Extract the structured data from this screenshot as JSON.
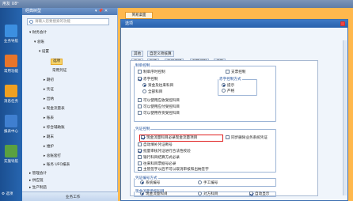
{
  "window": {
    "title": "用友 U8⁺"
  },
  "left_nav": [
    {
      "label": "业务导航",
      "color": "#3c8fe0"
    },
    {
      "label": "常用功能",
      "color": "#e8752a"
    },
    {
      "label": "消息任务",
      "color": "#f0a020"
    },
    {
      "label": "报表中心",
      "color": "#3f7fd0"
    },
    {
      "label": "实施导航",
      "color": "#5aa040"
    }
  ],
  "left_nav_bottom": "⚙ 选项",
  "sidebar": {
    "title": "经典树型",
    "controls": "▾ 📌 ✕",
    "search_placeholder": "请输入您要搜索的功能",
    "tree": [
      "▾ 财务会计",
      "▾ 总账",
      "▾ 设置",
      "选项",
      "常用凭证",
      "▸ 期初",
      "▸ 凭证",
      "▸ 出纳",
      "▸ 现金流量表",
      "▸ 账表",
      "▸ 综合辅助账",
      "▸ 期末",
      "▸ 维护",
      "▸ 总账套打",
      "▸ 账务 UFO报表",
      "▸ 管理会计",
      "▸ 供应链",
      "▸ 生产制造",
      "▸ 内部控制"
    ],
    "footer": "业务工作"
  },
  "main": {
    "tab": "简易桌面"
  },
  "dialog": {
    "title": "选项",
    "tabs_row1": [
      "其他",
      "自定义项核算"
    ],
    "tabs_row2": [
      "凭证",
      "账簿",
      "凭证打印",
      "预算控制",
      "权限"
    ],
    "sec1": {
      "legend": "制单控制",
      "opts": [
        "制单序时控制",
        "支票控制",
        "赤字控制",
        "资金及往来科目",
        "全部科目",
        "可以使用应收受控科目",
        "可以使用应付受控科目",
        "可以使用存货受控科目"
      ],
      "right": "支票控制"
    },
    "sub1": {
      "legend": "赤字控制方式",
      "opts": [
        "提示",
        "严格"
      ]
    },
    "sec2": {
      "legend": "凭证控制",
      "highlight": "现金流量科目必录现金流量项目",
      "opts": [
        "自动填补凭证断号",
        "批量审核凭证进行合法性校验",
        "银行科目结算方式必录",
        "往来科目票据号必录",
        "主管签字以后不可以取消审核和出纳签字"
      ],
      "right": "同步删除业务系统凭证"
    },
    "sec3": {
      "legend": "凭证编号方式",
      "opts": [
        "系统编号",
        "手工编号"
      ]
    },
    "sec4": {
      "legend": "现金流量参照科目",
      "opts": [
        "现金流量科目",
        "对方科目",
        "自动显示"
      ]
    }
  }
}
